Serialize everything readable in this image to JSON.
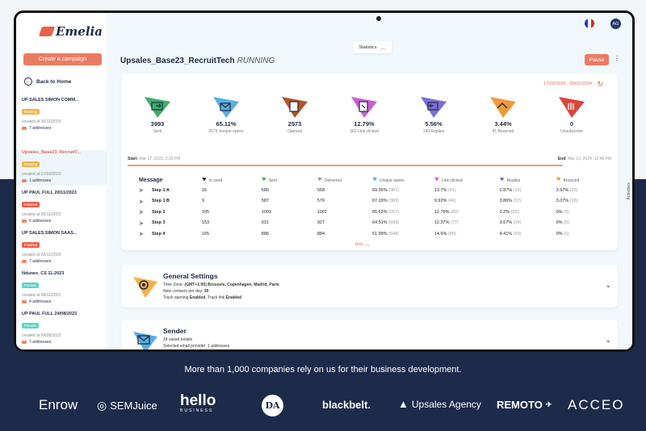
{
  "app": {
    "logo": "Emelia"
  },
  "sidebar": {
    "create_label": "Create a campaign",
    "back_label": "Back to Home",
    "campaigns": [
      {
        "name": "UP SALES SIMON COMM...",
        "status": "Running",
        "status_color": "#f0b44c",
        "created": "created at 20/11/2023",
        "addresses": "7 addresses"
      },
      {
        "name": "Upsales_Base23_RecruitT...",
        "status": "Running",
        "status_color": "#f0b44c",
        "created": "created at 17/03/2023",
        "addresses": "1 addresses"
      },
      {
        "name": "UP PAUL FULL 20/11/2023",
        "status": "Finished",
        "status_color": "#e8604a",
        "created": "created at 20/11/2023",
        "addresses": "6 addresses"
      },
      {
        "name": "UP SALES SIMON SAAS...",
        "status": "Finished",
        "status_color": "#e8604a",
        "created": "created at 20/11/2023",
        "addresses": "7 addresses"
      },
      {
        "name": "Ndunes_CS 11-2023",
        "status": "Paused",
        "status_color": "#5fd3c4",
        "created": "created at 08/11/2023",
        "addresses": "4 addresses"
      },
      {
        "name": "UP PAUL FULL 24/08/2023",
        "status": "Paused",
        "status_color": "#5fd3c4",
        "created": "created at 24/08/2023",
        "addresses": "7 addresses"
      }
    ]
  },
  "header": {
    "avatar": "AG",
    "stats_tab": "Statistics",
    "title": "Upsales_Base23_RecruitTech",
    "status": "RUNNING",
    "pause_label": "Pause"
  },
  "stats": {
    "daterange": "17/03/2023 - 05/01/2024",
    "metrics": [
      {
        "value": "3993",
        "label": "Sent",
        "color": "#3fae6a",
        "icon": "send-icon"
      },
      {
        "value": "65.11%",
        "label": "2573 Unique opens",
        "color": "#5aaee0",
        "icon": "open-envelope-icon"
      },
      {
        "value": "2573",
        "label": "Opened",
        "color": "#b0552a",
        "icon": "opened-icon"
      },
      {
        "value": "12.79%",
        "label": "362 Link clicked",
        "color": "#c85fd0",
        "icon": "link-click-icon"
      },
      {
        "value": "5.56%",
        "label": "143 Replies",
        "color": "#7c6fd6",
        "icon": "reply-icon"
      },
      {
        "value": "3.44%",
        "label": "41 Bounced",
        "color": "#f09a3a",
        "icon": "bounce-icon"
      },
      {
        "value": "0",
        "label": "Unsubscribe",
        "color": "#d8473b",
        "icon": "unsubscribe-icon"
      }
    ],
    "start_label": "Start:",
    "start_date": "Mar 17, 2023, 2:23 PM",
    "end_label": "End:",
    "end_date": "Mar 13, 2024, 12:48 PM",
    "progress": 0.9,
    "columns": [
      "Message",
      "to send",
      "Sent",
      "Delivered",
      "Unique opens",
      "Link clicked",
      "Replies",
      "Bounced"
    ],
    "rows": [
      {
        "step": "Step 1 A",
        "to_send": "16",
        "sent": "580",
        "delivered": "558",
        "opens": "69.35%",
        "opens_n": "(387)",
        "clicked": "13.7%",
        "clicked_n": "(61)",
        "replies": "2.87%",
        "replies_n": "(16)",
        "bounced": "3.97%",
        "bounced_n": "(23)"
      },
      {
        "step": "Step 1 B",
        "to_send": "9",
        "sent": "587",
        "delivered": "570",
        "opens": "67.19%",
        "opens_n": "(383)",
        "clicked": "9.92%",
        "clicked_n": "(46)",
        "replies": "3.86%",
        "replies_n": "(22)",
        "bounced": "3.07%",
        "bounced_n": "(18)"
      },
      {
        "step": "Step 2",
        "to_send": "105",
        "sent": "1009",
        "delivered": "1001",
        "opens": "65.63%",
        "opens_n": "(657)",
        "clicked": "12.79%",
        "clicked_n": "(80)",
        "replies": "3.2%",
        "replies_n": "(32)",
        "bounced": "0%",
        "bounced_n": "(0)"
      },
      {
        "step": "Step 3",
        "to_send": "153",
        "sent": "931",
        "delivered": "927",
        "opens": "64.51%",
        "opens_n": "(598)",
        "clicked": "12.37%",
        "clicked_n": "(77)",
        "replies": "3.67%",
        "replies_n": "(34)",
        "bounced": "0%",
        "bounced_n": "(0)"
      },
      {
        "step": "Step 4",
        "to_send": "165",
        "sent": "886",
        "delivered": "884",
        "opens": "61.99%",
        "opens_n": "(548)",
        "clicked": "14.6%",
        "clicked_n": "(80)",
        "replies": "4.41%",
        "replies_n": "(39)",
        "bounced": "0%",
        "bounced_n": "(0)"
      }
    ],
    "less_label": "less"
  },
  "general": {
    "title": "General Settings",
    "tz_label": "Time Zone:",
    "tz_value": "(GMT+1:00) Brussels, Copenhagen, Madrid, Paris",
    "contacts_label": "New contacts per day:",
    "contacts_value": "30",
    "track_label1": "Track opening",
    "track_value1": "Enabled",
    "track_label2": ", Track link",
    "track_value2": "Enabled"
  },
  "sender": {
    "title": "Sender",
    "line1": "18 saved emails",
    "line2": "Selected email provider: 1 addresses"
  },
  "activities_label": "Activities",
  "marketing": {
    "tagline": "More than 1,000 companies rely on us for their business development.",
    "logos": [
      "Enrow",
      "SEMJuice",
      "hello",
      "BUSINESS",
      "DA",
      "blackbelt.",
      "Upsales Agency",
      "REMOTO",
      "ACCEO"
    ]
  }
}
